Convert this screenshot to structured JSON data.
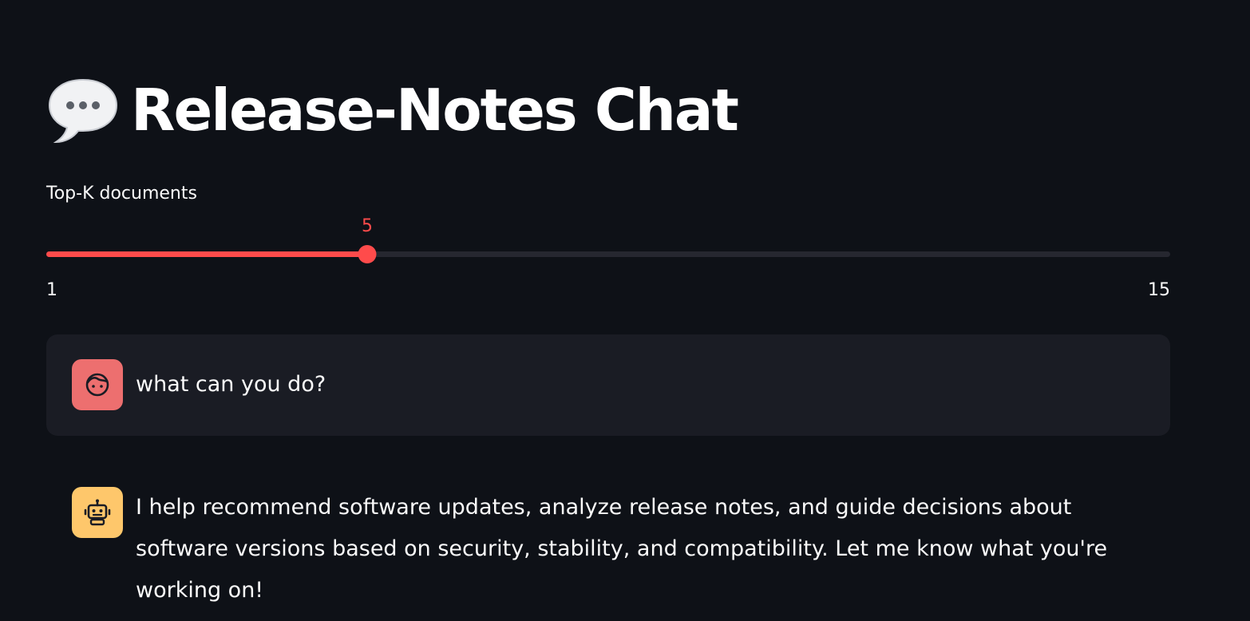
{
  "header": {
    "title": "Release-Notes Chat",
    "icon": "speech-balloon-icon"
  },
  "slider": {
    "label": "Top-K documents",
    "value": "5",
    "min": "1",
    "max": "15",
    "fraction": 0.2857,
    "accent_color": "#ff4b4b"
  },
  "messages": [
    {
      "role": "user",
      "avatar_icon": "user-face-icon",
      "avatar_color": "#ed6f6f",
      "text": "what can you do?"
    },
    {
      "role": "assistant",
      "avatar_icon": "robot-icon",
      "avatar_color": "#fec76b",
      "text": "I help recommend software updates, analyze release notes, and guide decisions about software versions based on security, stability, and compatibility. Let me know what you're working on!"
    }
  ]
}
